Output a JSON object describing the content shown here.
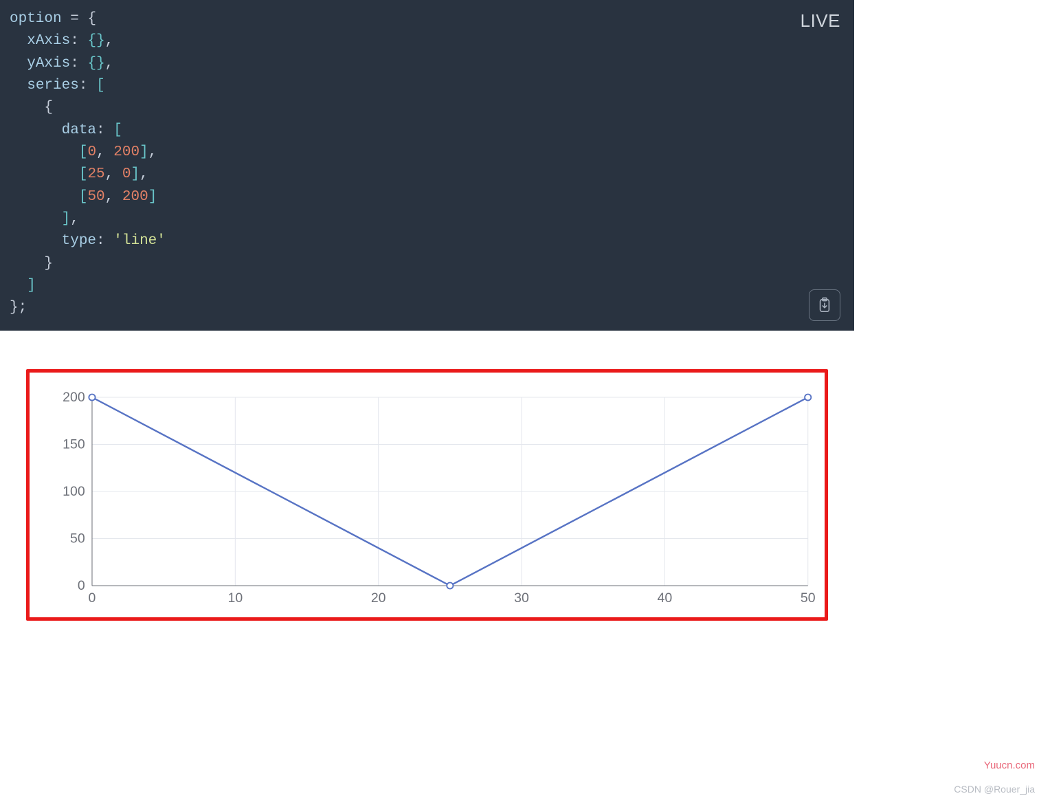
{
  "editor": {
    "live_badge": "LIVE",
    "tok": {
      "option": "option",
      "eq": "=",
      "ob": "{",
      "cb": "}",
      "obr": "[",
      "cbr": "]",
      "comma": ",",
      "semic": ";",
      "colon": ":",
      "sq": "'",
      "xAxis": "xAxis",
      "yAxis": "yAxis",
      "series": "series",
      "data": "data",
      "type": "type",
      "lineStr": "line",
      "n0": "0",
      "n25": "25",
      "n50": "50",
      "n200": "200"
    }
  },
  "chart_data": {
    "type": "line",
    "x": [
      0,
      25,
      50
    ],
    "y": [
      200,
      0,
      200
    ],
    "x_ticks": [
      0,
      10,
      20,
      30,
      40,
      50
    ],
    "y_ticks": [
      0,
      50,
      100,
      150,
      200
    ],
    "xlim": [
      0,
      50
    ],
    "ylim": [
      0,
      200
    ]
  },
  "watermark1": "Yuucn.com",
  "watermark2": "CSDN @Rouer_jia"
}
